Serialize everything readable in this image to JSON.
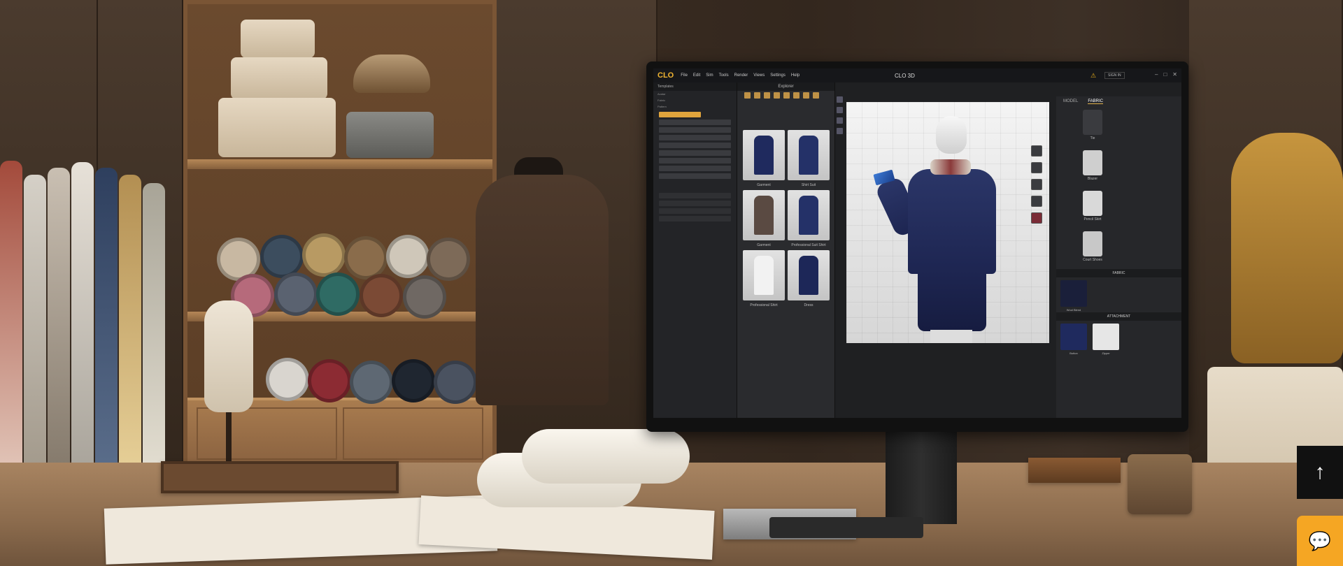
{
  "app": {
    "logo_text": "CLO",
    "window_title": "CLO 3D",
    "menu": [
      "File",
      "Edit",
      "Sim",
      "Tools",
      "Render",
      "Views",
      "Settings",
      "Help"
    ],
    "signin_label": "SIGN IN",
    "warning_icon": "warning-icon"
  },
  "explorer": {
    "title": "Explorer",
    "garments": [
      {
        "label": "Garment",
        "color": "#1f2a5e"
      },
      {
        "label": "Shirt Suit",
        "color": "#243168"
      },
      {
        "label": "Garment",
        "color": "#5a4a42"
      },
      {
        "label": "Professional Suit Shirt",
        "color": "#243168"
      },
      {
        "label": "Professional Shirt",
        "color": "#f2f2f2"
      },
      {
        "label": "Dress",
        "color": "#1d2758"
      }
    ]
  },
  "left_panel": {
    "items": [
      "Templates",
      "Avatar",
      "Fabric",
      "Pattern"
    ]
  },
  "library": {
    "tabs": [
      "MODEL",
      "FABRIC"
    ],
    "items": [
      {
        "label": "Tie",
        "color": "#3a3b3f"
      },
      {
        "label": "Blazer",
        "color": "#cfcfcf"
      },
      {
        "label": "Pencil Skirt",
        "color": "#d9d9d9"
      },
      {
        "label": "Court Shoes",
        "color": "#c8c8c8"
      }
    ],
    "fabric_section": "FABRIC",
    "fabric_item": "Wool Blend",
    "attach_section": "ATTACHMENT",
    "swatches": [
      {
        "label": "Button",
        "color": "#1f2a5e"
      },
      {
        "label": "Zipper",
        "color": "#e6e6e6"
      }
    ]
  },
  "colors": {
    "accent": "#f1b531",
    "navy_suit": "#1d2551",
    "chat_button": "#f5a623"
  },
  "page": {
    "scroll_top_icon": "↑",
    "chat_icon": "💬"
  }
}
